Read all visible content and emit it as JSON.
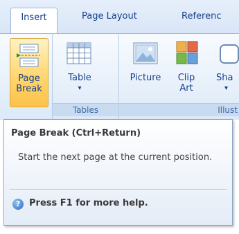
{
  "tabs": [
    {
      "label": "Insert",
      "active": true
    },
    {
      "label": "Page Layout",
      "active": false
    },
    {
      "label": "Referenc",
      "active": false
    }
  ],
  "ribbon": {
    "page_break": {
      "line1": "Page",
      "line2": "Break"
    },
    "table": {
      "label": "Table",
      "arrow": "▾"
    },
    "picture": {
      "label": "Picture"
    },
    "clip_art": {
      "line1": "Clip",
      "line2": "Art"
    },
    "shapes": {
      "line1": "Sha",
      "arrow": "▾"
    },
    "groups": {
      "tables": "Tables",
      "illustrations": "Illust"
    }
  },
  "tooltip": {
    "title": "Page Break (Ctrl+Return)",
    "description": "Start the next page at the current position.",
    "help": "Press F1 for more help."
  },
  "colors": {
    "accent": "#15428b",
    "highlight": "#ffd46a",
    "ribbon_bg": "#dde9f7"
  }
}
